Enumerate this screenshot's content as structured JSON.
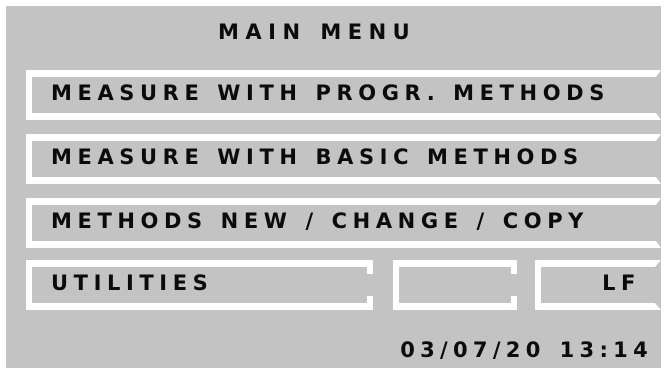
{
  "menu": {
    "title": "MAIN MENU",
    "items": [
      {
        "label": "MEASURE WITH PROGR. METHODS"
      },
      {
        "label": "MEASURE WITH BASIC METHODS"
      },
      {
        "label": "METHODS NEW / CHANGE / COPY"
      },
      {
        "label": "UTILITIES"
      },
      {
        "label": ""
      },
      {
        "label": "LF"
      }
    ]
  },
  "status": {
    "date": "03/07/20",
    "time": "13:14"
  },
  "colors": {
    "screen_background": "#c3c3c3",
    "text": "#0b0b0b",
    "button_frame": "#ffffff"
  }
}
